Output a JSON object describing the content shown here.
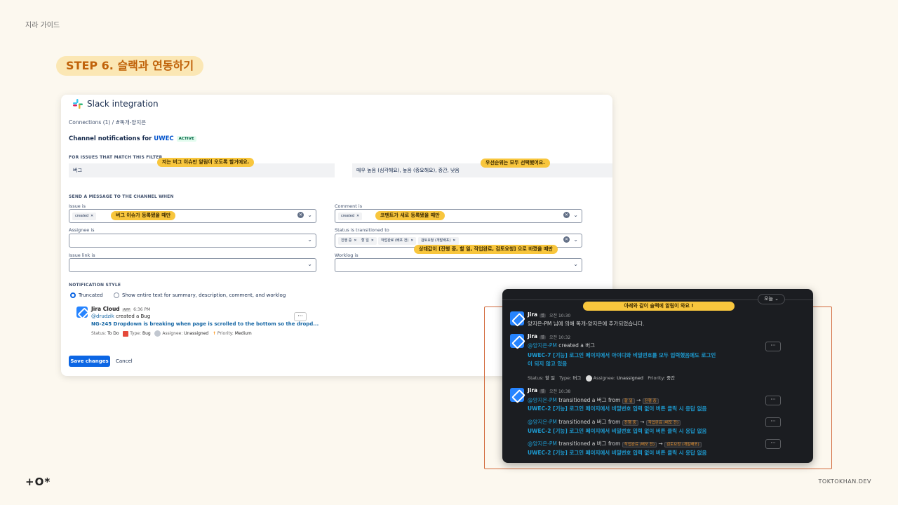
{
  "guide_label": "지라 가이드",
  "step_title": "STEP 6. 슬랙과 연동하기",
  "panel": {
    "title": "Slack integration",
    "breadcrumb": "Connections (1)   /   #똑개-양지은",
    "channel_prefix": "Channel notifications for ",
    "project": "UWEC",
    "status": "ACTIVE",
    "filter_header": "FOR ISSUES THAT MATCH THIS FILTER",
    "filter_type": "버그",
    "filter_priority": "매우 높음 (심각해요), 높음 (중요해요), 중간, 낮음",
    "send_header": "SEND A MESSAGE TO THE CHANNEL WHEN",
    "fields": {
      "issue_is": "Issue is",
      "comment_is": "Comment is",
      "assignee_is": "Assignee is",
      "status_transitioned": "Status is transitioned to",
      "issue_link_is": "Issue link is",
      "worklog_is": "Worklog is"
    },
    "chips": {
      "issue": "created",
      "comment": "created",
      "status": [
        "진행 중",
        "할 일",
        "작업완료 (배포 전)",
        "검토요청 (개발배포)"
      ]
    },
    "style_header": "NOTIFICATION STYLE",
    "radio_truncated": "Truncated",
    "radio_full": "Show entire text for summary, description, comment, and worklog",
    "preview": {
      "app_name": "Jira Cloud",
      "app_tag": "APP",
      "time": "6:36 PM",
      "user": "@drudzik",
      "action": " created a Bug",
      "issue_link": "NG-245 Dropdown is breaking when page is scrolled to the bottom so the dropd...",
      "status_label": "Status: ",
      "status_value": "To Do",
      "type_label": "Type: ",
      "type_value": "Bug",
      "assignee_label": "Assignee: ",
      "assignee_value": "Unassigned",
      "priority_label": "Priority: ",
      "priority_value": "Medium",
      "more": "···"
    },
    "save": "Save changes",
    "cancel": "Cancel"
  },
  "callouts": {
    "type": "저는 버그 이슈만 알림이 오도록 할거에요.",
    "priority": "우선순위는 모두 선택했어요.",
    "issue": "버그 이슈가 등록됐을 때만",
    "comment": "코멘트가 새로 등록됐을 때만",
    "status": "상태값이 [진행 중, 할 일, 작업완료, 검토요청] 으로 바꼈을 때만",
    "slack": "아래와 같이 슬랙에 알림이 와요 !"
  },
  "slack": {
    "date_pill": "오늘",
    "messages": [
      {
        "name": "Jira",
        "tag": "앱",
        "time": "오전 10:30",
        "text": "양지은-PM 님에 의해 똑개-양지은에 추가되었습니다."
      },
      {
        "name": "Jira",
        "tag": "앱",
        "time": "오전 10:32",
        "mention": "@양지은-PM",
        "action": " created a 버그",
        "link1": "UWEC-7 [기능] 로그인 페이지에서 아이디와 비밀번호를 모두 입력했음에도 로그인",
        "link2": "이 되지 않고 있음",
        "status_label": "Status: ",
        "status_value": "할 일",
        "type_label": "Type: ",
        "type_value": "버그",
        "assignee_label": "Assignee: ",
        "assignee_value": "Unassigned",
        "priority_label": "Priority: ",
        "priority_value": "중간"
      },
      {
        "name": "Jira",
        "tag": "앱",
        "time": "오전 10:38"
      }
    ],
    "transitions": [
      {
        "mention": "@양지은-PM",
        "action": " transitioned a 버그 from ",
        "from": "할 일",
        "to": "진행 중",
        "link": "UWEC-2 [기능] 로그인 페이지에서 비밀번호 입력 없이 버튼 클릭 시 응답 없음"
      },
      {
        "mention": "@양지은-PM",
        "action": " transitioned a 버그 from ",
        "from": "진행 중",
        "to": "작업완료 (배포 전)",
        "link": "UWEC-2 [기능] 로그인 페이지에서 비밀번호 입력 없이 버튼 클릭 시 응답 없음"
      },
      {
        "mention": "@양지은-PM",
        "action": " transitioned a 버그 from ",
        "from": "작업완료 (배포 전)",
        "to": "검토요청 (개발배포)",
        "link": "UWEC-2 [기능] 로그인 페이지에서 비밀번호 입력 없이 버튼 클릭 시 응답 없음"
      }
    ],
    "more": "···"
  },
  "footer": {
    "logo": "+O*",
    "site": "TOKTOKHAN.DEV"
  }
}
